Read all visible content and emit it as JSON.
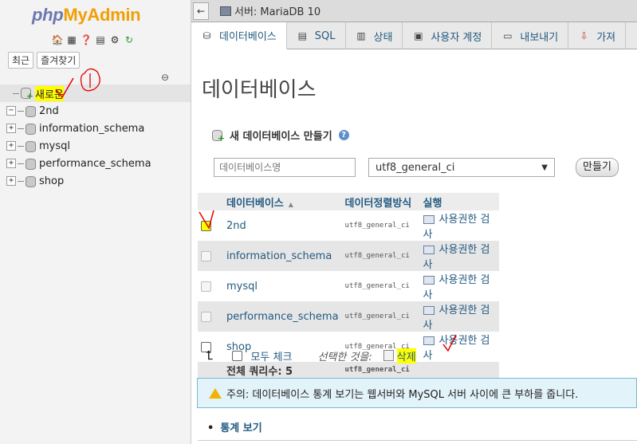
{
  "nav": {
    "logo_php": "php",
    "logo_myadmin": "MyAdmin",
    "icons": [
      "home-icon",
      "sql-icon",
      "help-icon",
      "docs-icon",
      "settings-icon",
      "reload-icon"
    ],
    "recent_label": "최근",
    "favorites_label": "즐겨찾기",
    "link_icon": "link-icon",
    "new_label": "새로운",
    "databases": [
      "2nd",
      "information_schema",
      "mysql",
      "performance_schema",
      "shop"
    ]
  },
  "topbar": {
    "back": "←",
    "breadcrumb": "서버: MariaDB 10"
  },
  "tabs": [
    {
      "label": "데이터베이스",
      "icon": "database-icon"
    },
    {
      "label": "SQL",
      "icon": "sql-icon"
    },
    {
      "label": "상태",
      "icon": "status-icon"
    },
    {
      "label": "사용자 계정",
      "icon": "users-icon"
    },
    {
      "label": "내보내기",
      "icon": "export-icon"
    },
    {
      "label": "가져",
      "icon": "import-icon"
    }
  ],
  "main": {
    "title": "데이터베이스",
    "create_heading": "새 데이터베이스 만들기",
    "db_name_placeholder": "데이터베이스명",
    "collation_selected": "utf8_general_ci",
    "create_button": "만들기",
    "table": {
      "col_database": "데이터베이스",
      "col_collation": "데이터정렬방식",
      "col_action": "실행",
      "rows": [
        {
          "name": "2nd",
          "collation": "utf8_general_ci",
          "action": "사용권한 검사"
        },
        {
          "name": "information_schema",
          "collation": "utf8_general_ci",
          "action": "사용권한 검사"
        },
        {
          "name": "mysql",
          "collation": "utf8_general_ci",
          "action": "사용권한 검사"
        },
        {
          "name": "performance_schema",
          "collation": "utf8_general_ci",
          "action": "사용권한 검사"
        },
        {
          "name": "shop",
          "collation": "utf8_general_ci",
          "action": "사용권한 검사"
        }
      ],
      "total_label": "전체 쿼리수: 5",
      "total_collation": "utf8_general_ci"
    },
    "check_all_label": "모두 체크",
    "with_selected": "선택한 것을:",
    "delete_label": "삭제",
    "notice": "주의: 데이터베이스 통계 보기는 웹서버와 MySQL 서버 사이에 큰 부하를 줍니다.",
    "stats_link": "통계 보기"
  },
  "colors": {
    "link": "#235a81",
    "highlight": "#ffff00",
    "ink": "#e60000",
    "notice_bg": "#e2f3f9"
  }
}
